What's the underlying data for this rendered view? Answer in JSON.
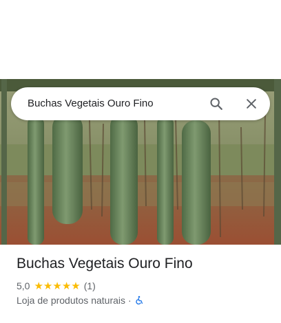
{
  "search": {
    "query": "Buchas Vegetais Ouro Fino",
    "search_icon": "search-icon",
    "close_icon": "close-icon"
  },
  "photo": {
    "description_icon": "place-photo"
  },
  "place": {
    "name": "Buchas Vegetais Ouro Fino",
    "rating": "5,0",
    "stars": 5,
    "review_count": "(1)",
    "category": "Loja de produtos naturais",
    "separator": "·",
    "accessibility_icon": "wheelchair-accessible-icon"
  },
  "colors": {
    "star": "#fbbc04",
    "accessibility": "#1a73e8",
    "title": "#202124",
    "secondary": "#5f6368"
  }
}
